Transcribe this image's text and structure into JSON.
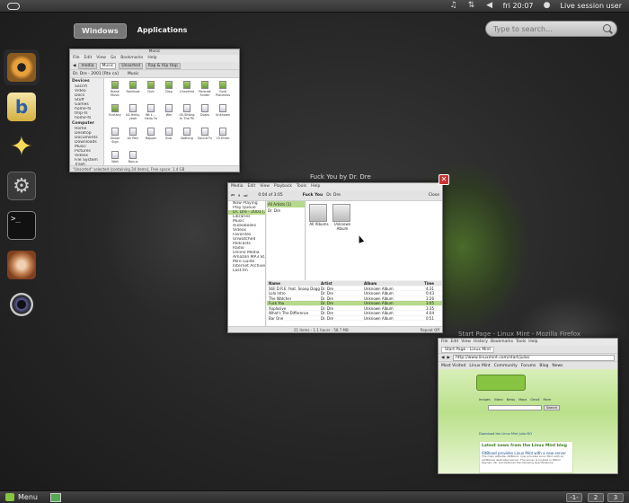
{
  "top_panel": {
    "clock": "fri 20:07",
    "session": "Live session user",
    "tray_icons": [
      "music-icon",
      "network-icon",
      "volume-icon"
    ]
  },
  "overview": {
    "tabs": [
      {
        "label": "Windows",
        "active": true
      },
      {
        "label": "Applications",
        "active": false
      }
    ],
    "search_placeholder": "Type to search..."
  },
  "dash": {
    "items": [
      "eye-of-gnome-icon",
      "banshee-icon",
      "favorites-star-icon",
      "system-settings-icon",
      "terminal-icon",
      "snail-icon",
      "camera-icon"
    ]
  },
  "nautilus": {
    "title": "Music",
    "menu": [
      "File",
      "Edit",
      "View",
      "Go",
      "Bookmarks",
      "Help"
    ],
    "breadcrumbs": [
      "media",
      "Music",
      "Unsorted",
      "Rap & Hip Hop"
    ],
    "address": "Dr. Dre - 2001 [Rtx ca]",
    "location": "Music",
    "sidebar": {
      "devices_header": "Devices",
      "devices": [
        "Sacrifi",
        "Video",
        "Docs"
      ],
      "other_items": [
        "Stuff",
        "Games",
        "home-fs",
        "tmp-fs",
        "home-fs"
      ],
      "computer_header": "Computer",
      "computer": [
        "Home",
        "Desktop",
        "Documents",
        "Downloads",
        "Music",
        "Pictures",
        "Videos",
        "File System",
        "Trash"
      ]
    },
    "files": [
      "Blank Music",
      "Rainbow",
      "Dub",
      "Disp",
      "Unsorted",
      "Podcast Folder",
      "Gold Placeless",
      "Ecstacy",
      "04-Hello-yeah",
      "Wt t-- -Hello Fo",
      "Wm",
      "05-Sitting In The Pk",
      "Doors",
      "Unknown",
      "Dollar Sign",
      "All Pain",
      "Rapper",
      "Scar",
      "Nothing",
      "Sound Fx",
      "15-Ether",
      "Wait",
      "Bonus"
    ],
    "status": "\"Unsorted\" selected (containing 34 items), Free space: 1.4 GB"
  },
  "banshee": {
    "caption": "Fuck You by Dr. Dre",
    "menu": [
      "Media",
      "Edit",
      "View",
      "Playback",
      "Tools",
      "Help"
    ],
    "now_playing_title": "Fuck You",
    "now_playing_artist": "Dr. Dre",
    "time": "0:04 of 3:05",
    "close_label": "Close",
    "sidebar_items": [
      "Now Playing",
      "Play Queue",
      "Dr. Dre - 2001 [3]",
      "Libraries",
      "Music",
      "Audiobooks",
      "Videos",
      "Favorites",
      "Unwatched",
      "Podcasts",
      "Radio",
      "Online Media",
      "Amazon MP3 St...",
      "Miro Guide",
      "Internet Archive",
      "Last.fm"
    ],
    "artist_list": [
      "All Artists (1)",
      "Dr. Dre"
    ],
    "albums": [
      "All Albums",
      "Unknown Album"
    ],
    "columns": [
      "Name",
      "Artist",
      "Album",
      "Time"
    ],
    "tracks": [
      {
        "name": "Still D.R.E. feat. Snoop Dogg",
        "artist": "Dr. Dre",
        "album": "Unknown Album",
        "time": "4:31"
      },
      {
        "name": "Lolo Intro",
        "artist": "Dr. Dre",
        "album": "Unknown Album",
        "time": "0:43"
      },
      {
        "name": "The Watcher",
        "artist": "Dr. Dre",
        "album": "Unknown Album",
        "time": "3:26"
      },
      {
        "name": "Fuck You",
        "artist": "Dr. Dre",
        "album": "Unknown Album",
        "time": "3:05"
      },
      {
        "name": "Xxplosive",
        "artist": "Dr. Dre",
        "album": "Unknown Album",
        "time": "3:35"
      },
      {
        "name": "What's The Difference",
        "artist": "Dr. Dre",
        "album": "Unknown Album",
        "time": "4:04"
      },
      {
        "name": "Bar One",
        "artist": "Dr. Dre",
        "album": "Unknown Album",
        "time": "0:51"
      }
    ],
    "selected_track": 3,
    "status": "21 items - 1.1 hours - 58.7 MB",
    "repeat": "Repeat Off"
  },
  "firefox": {
    "caption": "Start Page - Linux Mint - Mozilla Firefox",
    "menu": [
      "File",
      "Edit",
      "View",
      "History",
      "Bookmarks",
      "Tools",
      "Help"
    ],
    "tab_label": "Start Page - Linux Mint",
    "url": "http://www.linuxmint.com/start/julia/",
    "bookmarks": [
      "Most Visited",
      "Linux Mint",
      "Community",
      "Forums",
      "Blog",
      "News"
    ],
    "site_nav": [
      "Images",
      "Video",
      "News",
      "Maps",
      "Gmail",
      "More"
    ],
    "search_button": "Search",
    "download_link": "Download the Linux Mint Julia ISO",
    "latest_news_title": "Latest news from the Linux Mint blog",
    "news_headline": "AltBlood provides Linux Mint with a new server",
    "news_body": "The main website, AltBlood, now provides Linux Mint with an additional dedicated server. The server is located in Milton Keynes, UK, and features the following specifications."
  },
  "bottom_panel": {
    "menu_label": "Menu",
    "workspaces": [
      "1",
      "2",
      "3"
    ],
    "show_desktop": "-1-"
  }
}
